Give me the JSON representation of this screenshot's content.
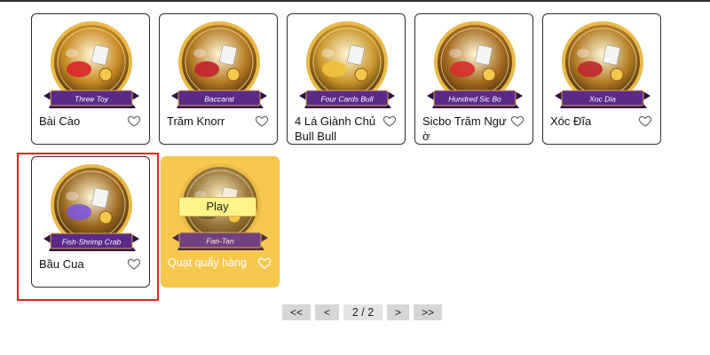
{
  "games": [
    {
      "id": "three-toy",
      "name": "Bài Cào",
      "banner": "Three Toy",
      "theme": "#c88a22",
      "accent": "#d7262a"
    },
    {
      "id": "baccarat",
      "name": "Trăm Knorr",
      "banner": "Baccarat",
      "theme": "#b47a24",
      "accent": "#c3222c"
    },
    {
      "id": "four-cards-bull",
      "name": "4 Lá Giành Chủ Bull Bull",
      "banner": "Four Cards Bull",
      "theme": "#c9962a",
      "accent": "#f0c23a"
    },
    {
      "id": "hundred-sic-bo",
      "name": "Sicbo Trăm Ngư ờ",
      "banner": "Hundred Sic Bo",
      "theme": "#a56b1f",
      "accent": "#d52d2d"
    },
    {
      "id": "xoc-dia",
      "name": "Xóc Đĩa",
      "banner": "Xoc Dia",
      "theme": "#b27c25",
      "accent": "#c0262a"
    },
    {
      "id": "fish-shrimp-crab",
      "name": "Bầu Cua",
      "banner": "Fish·Shrimp Crab",
      "theme": "#9c6b24",
      "accent": "#7c56d8"
    },
    {
      "id": "fan-tan",
      "name": "Quạt quẩy hàng",
      "banner": "Fan-Tan",
      "theme": "#8a6a3a",
      "accent": "#4a4a4a",
      "hover": true,
      "play_label": "Play"
    }
  ],
  "pagination": {
    "first": "<<",
    "prev": "<",
    "page": "2 / 2",
    "next": ">",
    "last": ">>"
  },
  "colors": {
    "card_border": "#2f2f2f",
    "hover_bg": "#f6c84f",
    "selection": "#e02020",
    "banner": "#5a2a8a"
  }
}
